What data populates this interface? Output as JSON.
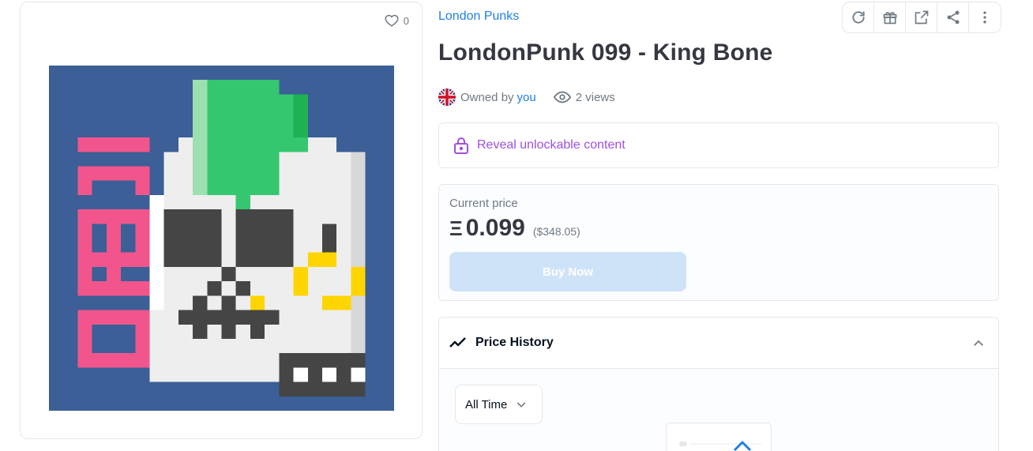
{
  "item": {
    "collection": "London Punks",
    "title": "LondonPunk 099 - King Bone",
    "favorites": "0",
    "owned_prefix": "Owned by",
    "owner": "you",
    "views": "2 views"
  },
  "unlockable": {
    "label": "Reveal unlockable content"
  },
  "price": {
    "label": "Current price",
    "currency_symbol": "Ξ",
    "value": "0.099",
    "usd": "($348.05)",
    "buy_label": "Buy Now"
  },
  "history": {
    "title": "Price History",
    "range": "All Time"
  },
  "toolbar": {
    "icons": [
      "refresh-icon",
      "gift-icon",
      "external-link-icon",
      "share-icon",
      "more-icon"
    ]
  },
  "colors": {
    "accent": "#2081e2",
    "unlock": "#9e50e1",
    "buy_disabled": "#cfe3f8",
    "art_background": "#3b5f96",
    "art_text": "#f2558b",
    "mohawk": "#34c76f"
  }
}
